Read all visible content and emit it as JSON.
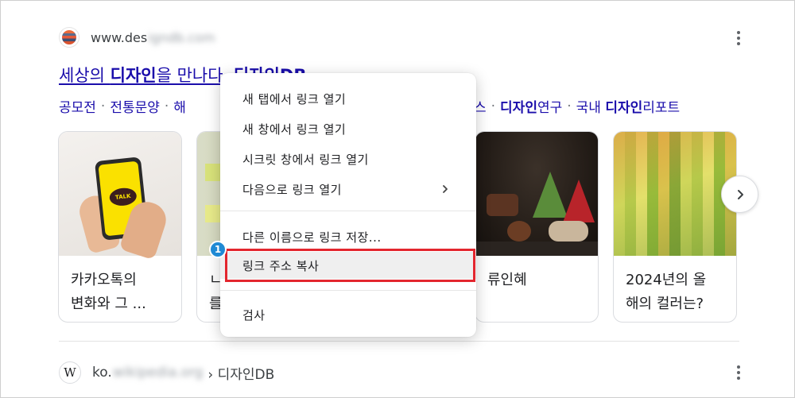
{
  "result1": {
    "url_visible": "www.des",
    "url_blurred": "igndb.com",
    "title_plain1": "세상의 ",
    "title_bold1": "디자인",
    "title_plain2": "을 만나다, ",
    "title_bold2": "디자인DB",
    "sitelinks_left": [
      "공모전",
      "전통문양",
      "해"
    ],
    "sitelinks_right_partial": "스",
    "sitelinks_right": [
      {
        "bold": "디자인",
        "plain": "연구"
      },
      {
        "plain": "국내 ",
        "bold": "디자인",
        "plain2": "리포트"
      }
    ],
    "separator": "·"
  },
  "cards": [
    {
      "caption_line1": "카카오톡의",
      "caption_line2": "변화와 그 ..."
    },
    {
      "caption_line1": "ㄴ",
      "caption_line2": "를"
    },
    {
      "caption_line1": "류인혜",
      "caption_line2": ""
    },
    {
      "caption_line1": "2024년의 올",
      "caption_line2": "해의 컬러는?"
    }
  ],
  "kakao_bubble": "TALK",
  "result2": {
    "url_visible": "ko.",
    "url_blurred": "wikipedia.org",
    "crumb": "› 디자인DB",
    "favicon_letter": "W"
  },
  "context_menu": {
    "items_group1": [
      "새 탭에서 링크 열기",
      "새 창에서 링크 열기",
      "시크릿 창에서 링크 열기",
      "다음으로 링크 열기"
    ],
    "submenu_arrow": "›",
    "items_group2": [
      "다른 이름으로 링크 저장...",
      "링크 주소 복사"
    ],
    "items_group3": [
      "검사"
    ],
    "highlighted": "링크 주소 복사"
  },
  "annotation_badge": "1",
  "colors": {
    "link": "#1a0dab",
    "highlight_border": "#e3262e",
    "badge": "#1f8ad4"
  },
  "icons": [
    "more-vert-icon",
    "chevron-right-icon",
    "submenu-arrow-icon"
  ]
}
